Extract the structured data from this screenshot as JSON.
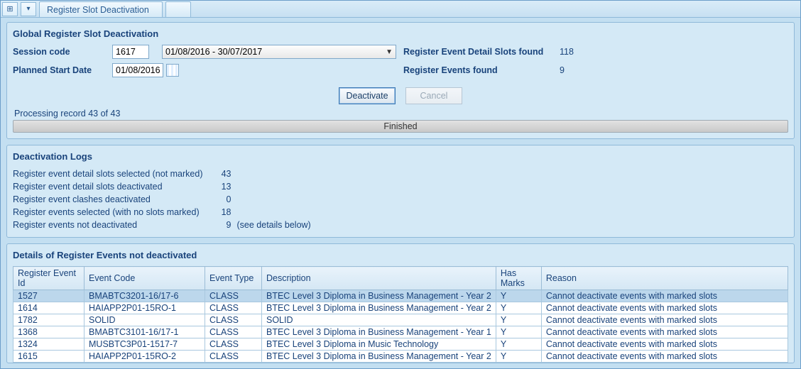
{
  "tab_title": "Register Slot Deactivation",
  "panel1": {
    "title": "Global Register Slot Deactivation",
    "labels": {
      "session_code": "Session code",
      "planned_start": "Planned Start Date",
      "slots_found": "Register Event Detail Slots found",
      "events_found": "Register Events found"
    },
    "values": {
      "session_code": "1617",
      "session_range": "01/08/2016 - 30/07/2017",
      "planned_start": "01/08/2016",
      "slots_found": "118",
      "events_found": "9"
    },
    "buttons": {
      "deactivate": "Deactivate",
      "cancel": "Cancel"
    },
    "processing_line": "Processing record 43 of 43",
    "progress_text": "Finished"
  },
  "panel2": {
    "title": "Deactivation Logs",
    "rows": [
      {
        "label": "Register event detail slots selected (not marked)",
        "value": "43",
        "note": ""
      },
      {
        "label": "Register event detail slots deactivated",
        "value": "13",
        "note": ""
      },
      {
        "label": "Register event clashes deactivated",
        "value": "0",
        "note": ""
      },
      {
        "label": "Register events selected (with no slots marked)",
        "value": "18",
        "note": ""
      },
      {
        "label": "Register events not deactivated",
        "value": "9",
        "note": "(see details below)"
      }
    ]
  },
  "panel3": {
    "title": "Details of Register Events not deactivated",
    "headers": {
      "id": "Register Event Id",
      "code": "Event Code",
      "type": "Event Type",
      "desc": "Description",
      "marks": "Has Marks",
      "reason": "Reason"
    },
    "rows": [
      {
        "id": "1527",
        "code": "BMABTC3201-16/17-6",
        "type": "CLASS",
        "desc": "BTEC Level 3 Diploma in Business Management - Year 2",
        "marks": "Y",
        "reason": "Cannot deactivate events with marked slots"
      },
      {
        "id": "1614",
        "code": "HAIAPP2P01-15RO-1",
        "type": "CLASS",
        "desc": "BTEC Level 3 Diploma in Business Management - Year 2",
        "marks": "Y",
        "reason": "Cannot deactivate events with marked slots"
      },
      {
        "id": "1782",
        "code": "SOLID",
        "type": "CLASS",
        "desc": "SOLID",
        "marks": "Y",
        "reason": "Cannot deactivate events with marked slots"
      },
      {
        "id": "1368",
        "code": "BMABTC3101-16/17-1",
        "type": "CLASS",
        "desc": "BTEC Level 3 Diploma in Business Management - Year 1",
        "marks": "Y",
        "reason": "Cannot deactivate events with marked slots"
      },
      {
        "id": "1324",
        "code": "MUSBTC3P01-1517-7",
        "type": "CLASS",
        "desc": "BTEC Level 3 Diploma in Music Technology",
        "marks": "Y",
        "reason": "Cannot deactivate events with marked slots"
      },
      {
        "id": "1615",
        "code": "HAIAPP2P01-15RO-2",
        "type": "CLASS",
        "desc": "BTEC Level 3 Diploma in Business Management - Year 2",
        "marks": "Y",
        "reason": "Cannot deactivate events with marked slots"
      }
    ]
  }
}
